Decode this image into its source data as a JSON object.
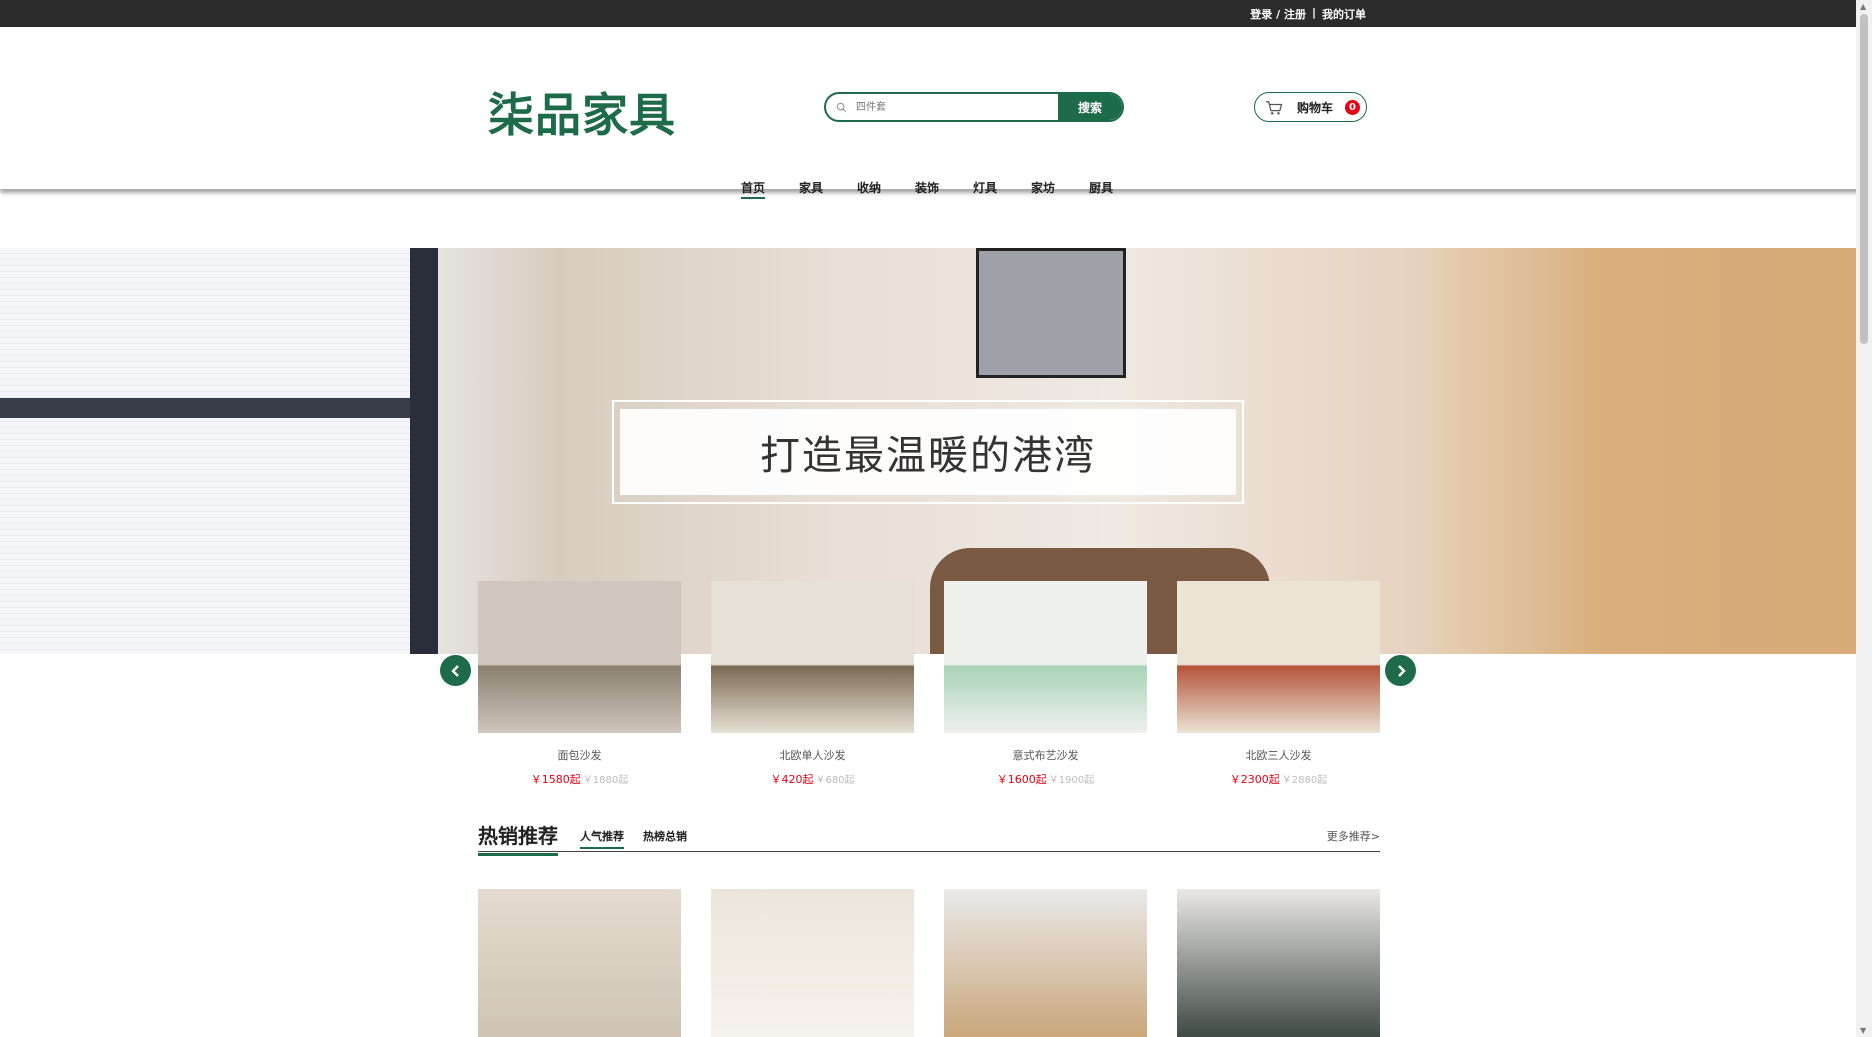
{
  "topbar": {
    "login": "登录 / 注册",
    "separator": "|",
    "orders": "我的订单"
  },
  "header": {
    "logo": "柒品家具",
    "search_placeholder": "四件套",
    "search_button": "搜索",
    "cart_label": "购物车",
    "cart_count": "0"
  },
  "nav": [
    {
      "label": "首页"
    },
    {
      "label": "家具"
    },
    {
      "label": "收纳"
    },
    {
      "label": "装饰"
    },
    {
      "label": "灯具"
    },
    {
      "label": "家坊"
    },
    {
      "label": "厨具"
    }
  ],
  "banner": {
    "title": "打造最温暖的港湾"
  },
  "carousel": [
    {
      "name": "面包沙发",
      "price": "￥1580起",
      "old_price": "￥1880起",
      "colors": [
        "#cfc7bd",
        "#8a7f72"
      ]
    },
    {
      "name": "北欧单人沙发",
      "price": "￥420起",
      "old_price": "￥680起",
      "colors": [
        "#e6e1d6",
        "#7a6a52"
      ]
    },
    {
      "name": "意式布艺沙发",
      "price": "￥1600起",
      "old_price": "￥1900起",
      "colors": [
        "#eef0ee",
        "#a9d3b7"
      ]
    },
    {
      "name": "北欧三人沙发",
      "price": "￥2300起",
      "old_price": "￥2880起",
      "colors": [
        "#ebe3d5",
        "#b5543b"
      ]
    }
  ],
  "section": {
    "title": "热销推荐",
    "tab_popular": "人气推荐",
    "tab_top": "热榜总销",
    "more": "更多推荐>"
  },
  "products": [
    {
      "colors": [
        "#e3dbd0",
        "#cfc4b4"
      ]
    },
    {
      "colors": [
        "#ece5dc",
        "#f6f2ec"
      ]
    },
    {
      "colors": [
        "#e9e9e9",
        "#c9a77a"
      ]
    },
    {
      "colors": [
        "#eae8e5",
        "#3f4a45"
      ]
    }
  ],
  "theme": {
    "accent": "#1e6b4a",
    "price": "#e60012"
  }
}
